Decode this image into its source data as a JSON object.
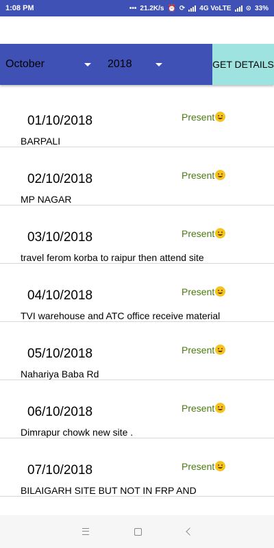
{
  "status_bar": {
    "time": "1:08 PM",
    "net_speed": "21.2K/s",
    "network": "4G VoLTE",
    "battery": "33%"
  },
  "filters": {
    "month": "October",
    "year": "2018",
    "get_details_label": "GET DETAILS"
  },
  "attendance": [
    {
      "date": "01/10/2018",
      "status": "Present",
      "place": "BARPALI"
    },
    {
      "date": "02/10/2018",
      "status": "Present",
      "place": "MP NAGAR"
    },
    {
      "date": "03/10/2018",
      "status": "Present",
      "place": "travel ferom korba to raipur then attend site Mahasamund but incomplete due to network issue and fault in ac and DG sites power"
    },
    {
      "date": "04/10/2018",
      "status": "Present",
      "place": "TVI warehouse and ATC office receive material then TVI site"
    },
    {
      "date": "05/10/2018",
      "status": "Present",
      "place": "Nahariya Baba Rd"
    },
    {
      "date": "06/10/2018",
      "status": "Present",
      "place": "Dimrapur chowk new site ."
    },
    {
      "date": "07/10/2018",
      "status": "Present",
      "place": "BILAIGARH SITE BUT NOT IN FRP AND"
    }
  ],
  "colors": {
    "primary": "#3f51b5",
    "button": "#9ee3df",
    "present_text": "#4a7a0e"
  }
}
